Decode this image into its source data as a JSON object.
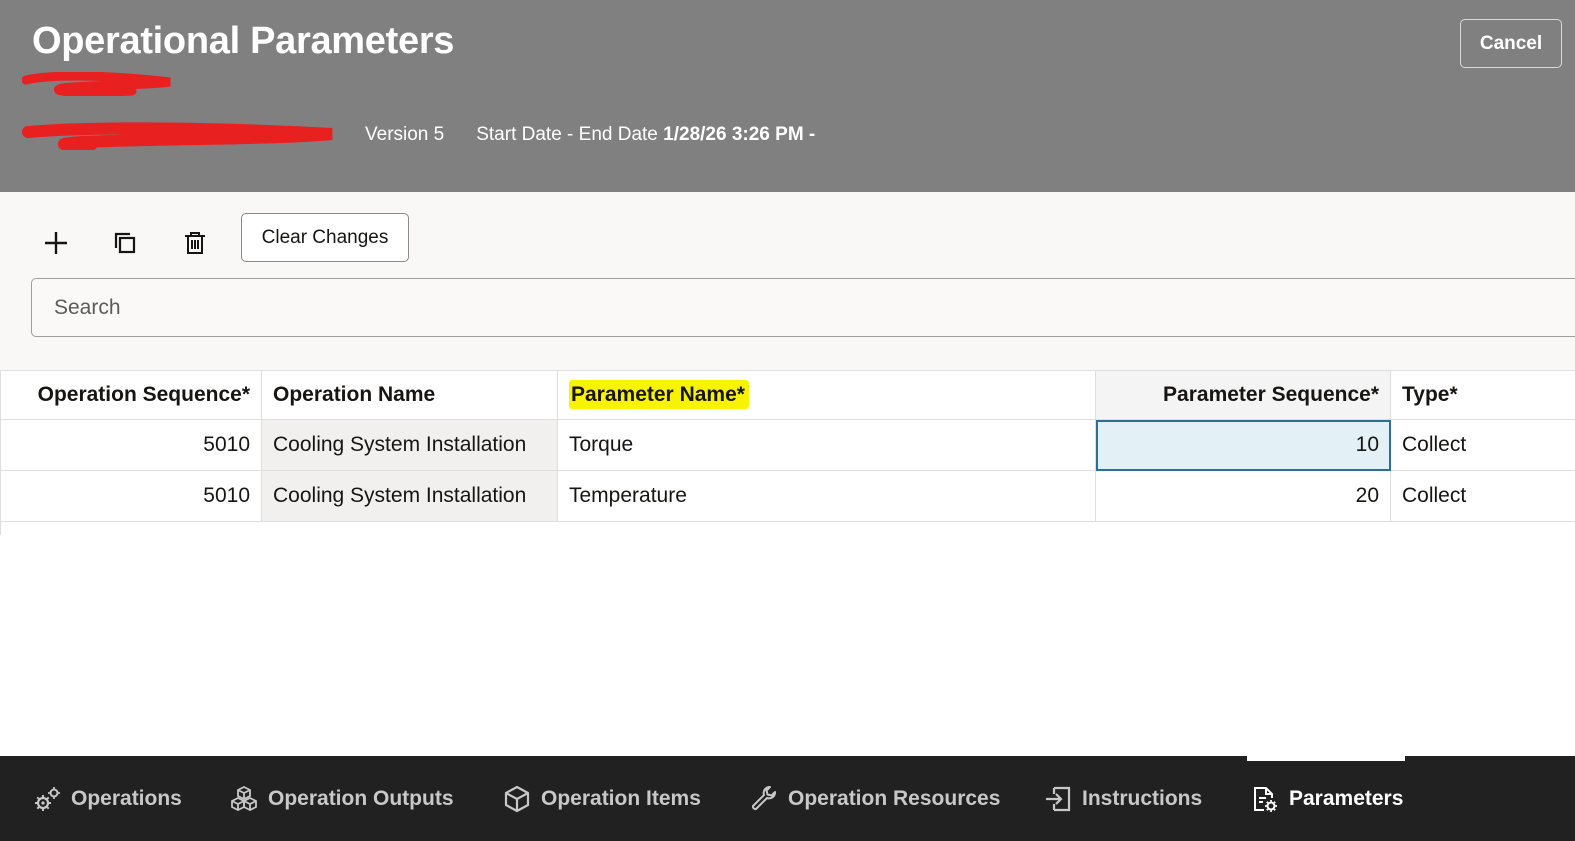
{
  "header": {
    "title": "Operational Parameters",
    "version": "Version 5",
    "date_label": "Start Date - End Date",
    "date_value": "1/28/26 3:26 PM -",
    "cancel_label": "Cancel"
  },
  "toolbar": {
    "clear_label": "Clear Changes",
    "search_placeholder": "Search"
  },
  "table": {
    "columns": [
      "Operation Sequence*",
      "Operation Name",
      "Parameter Name*",
      "Parameter Sequence*",
      "Type*"
    ],
    "rows": [
      {
        "op_seq": "5010",
        "op_name": "Cooling System Installation",
        "param_name": "Torque",
        "param_seq": "10",
        "type": "Collect"
      },
      {
        "op_seq": "5010",
        "op_name": "Cooling System Installation",
        "param_name": "Temperature",
        "param_seq": "20",
        "type": "Collect"
      }
    ]
  },
  "nav": {
    "items": [
      {
        "label": "Operations",
        "icon": "gears-icon"
      },
      {
        "label": "Operation Outputs",
        "icon": "cubes-icon"
      },
      {
        "label": "Operation Items",
        "icon": "box-icon"
      },
      {
        "label": "Operation Resources",
        "icon": "wrench-icon"
      },
      {
        "label": "Instructions",
        "icon": "enter-icon"
      },
      {
        "label": "Parameters",
        "icon": "doc-gear-icon"
      }
    ],
    "active": "Parameters"
  },
  "colors": {
    "header_bg": "#808080",
    "nav_bg": "#212121",
    "highlight": "#f8f400",
    "focus": "#2b6e98",
    "redaction": "#e8201f"
  }
}
